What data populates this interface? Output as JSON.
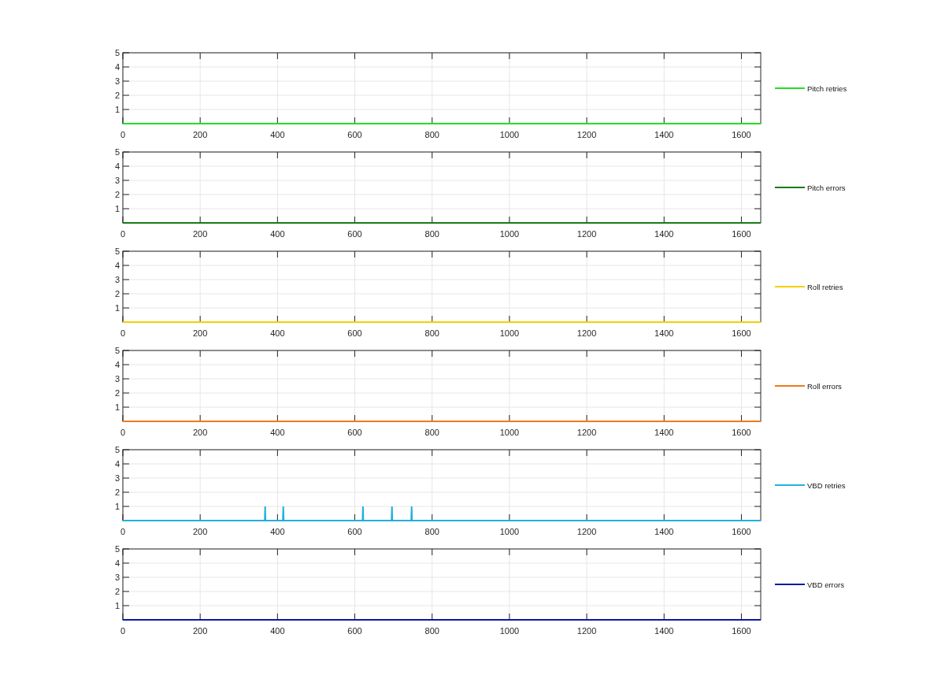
{
  "plots": [
    {
      "chart_data": {
        "type": "line",
        "xlim": [
          0,
          1650
        ],
        "ylim": [
          0,
          5
        ],
        "xticks": [
          0,
          200,
          400,
          600,
          800,
          1000,
          1200,
          1400,
          1600
        ],
        "yticks": [
          1,
          2,
          3,
          4,
          5
        ],
        "x": [
          0,
          1650
        ],
        "grid": true,
        "series": [
          {
            "name": "Pitch retries",
            "color": "#22e022",
            "values": [
              0,
              0
            ]
          }
        ]
      }
    },
    {
      "chart_data": {
        "type": "line",
        "xlim": [
          0,
          1650
        ],
        "ylim": [
          0,
          5
        ],
        "xticks": [
          0,
          200,
          400,
          600,
          800,
          1000,
          1200,
          1400,
          1600
        ],
        "yticks": [
          1,
          2,
          3,
          4,
          5
        ],
        "x": [
          0,
          1650
        ],
        "grid": true,
        "series": [
          {
            "name": "Pitch errors",
            "color": "#1a7a1a",
            "values": [
              0,
              0
            ]
          }
        ]
      }
    },
    {
      "chart_data": {
        "type": "line",
        "xlim": [
          0,
          1650
        ],
        "ylim": [
          0,
          5
        ],
        "xticks": [
          0,
          200,
          400,
          600,
          800,
          1000,
          1200,
          1400,
          1600
        ],
        "yticks": [
          1,
          2,
          3,
          4,
          5
        ],
        "x": [
          0,
          1650
        ],
        "grid": true,
        "series": [
          {
            "name": "Roll retries",
            "color": "#f5d000",
            "values": [
              0,
              0
            ]
          }
        ]
      }
    },
    {
      "chart_data": {
        "type": "line",
        "xlim": [
          0,
          1650
        ],
        "ylim": [
          0,
          5
        ],
        "xticks": [
          0,
          200,
          400,
          600,
          800,
          1000,
          1200,
          1400,
          1600
        ],
        "yticks": [
          1,
          2,
          3,
          4,
          5
        ],
        "x": [
          0,
          1650
        ],
        "grid": true,
        "series": [
          {
            "name": "Roll errors",
            "color": "#f07a18",
            "values": [
              0,
              0
            ]
          }
        ]
      }
    },
    {
      "chart_data": {
        "type": "line",
        "xlim": [
          0,
          1650
        ],
        "ylim": [
          0,
          5
        ],
        "xticks": [
          0,
          200,
          400,
          600,
          800,
          1000,
          1200,
          1400,
          1600
        ],
        "yticks": [
          1,
          2,
          3,
          4,
          5
        ],
        "x": [
          0,
          367,
          368,
          369,
          414,
          415,
          416,
          620,
          621,
          622,
          695,
          696,
          697,
          746,
          747,
          748,
          1650
        ],
        "grid": true,
        "series": [
          {
            "name": "VBD retries",
            "color": "#22b0dc",
            "values": [
              0,
              0,
              1,
              0,
              0,
              1,
              0,
              0,
              1,
              0,
              0,
              1,
              0,
              0,
              1,
              0,
              0
            ]
          }
        ]
      }
    },
    {
      "chart_data": {
        "type": "line",
        "xlim": [
          0,
          1650
        ],
        "ylim": [
          0,
          5
        ],
        "xticks": [
          0,
          200,
          400,
          600,
          800,
          1000,
          1200,
          1400,
          1600
        ],
        "yticks": [
          1,
          2,
          3,
          4,
          5
        ],
        "x": [
          0,
          1650
        ],
        "grid": true,
        "series": [
          {
            "name": "VBD errors",
            "color": "#0a1aa0",
            "values": [
              0,
              0
            ]
          }
        ]
      }
    }
  ]
}
